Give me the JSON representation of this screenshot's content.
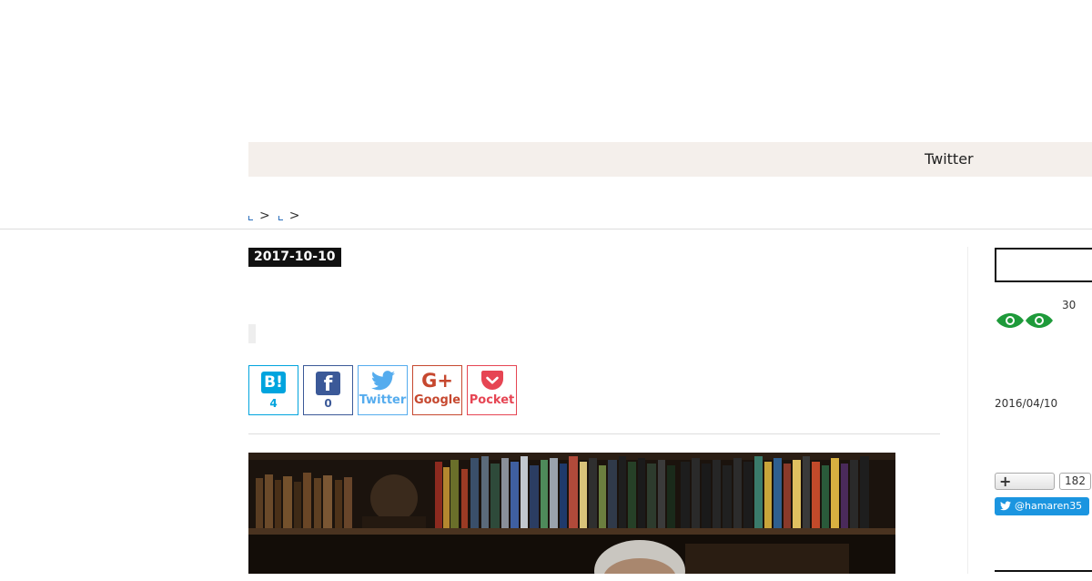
{
  "nav": {
    "twitter_label": "Twitter"
  },
  "breadcrumb": {
    "sep1": ">",
    "sep2": ">"
  },
  "article": {
    "date": "2017-10-10"
  },
  "share": {
    "hatena": {
      "logo": "B!",
      "count": "4"
    },
    "facebook": {
      "logo": "f",
      "count": "0"
    },
    "twitter": {
      "label": "Twitter"
    },
    "google": {
      "logo": "G+",
      "label": "Google"
    },
    "pocket": {
      "label": "Pocket"
    }
  },
  "sidebar": {
    "view_count": "30",
    "date": "2016/04/10",
    "follow_count": "182",
    "twitter_handle": "@hamaren35"
  },
  "colors": {
    "hatena": "#00a4de",
    "facebook": "#3b5998",
    "twitter": "#55acee",
    "google": "#c6482f",
    "pocket": "#e64553",
    "eye": "#1e9a3a",
    "nav_bg": "#f4efeb"
  },
  "icons": [
    "hatena-icon",
    "facebook-icon",
    "twitter-icon",
    "google-plus-icon",
    "pocket-icon",
    "eye-icon",
    "plus-icon",
    "twitter-bird-icon"
  ]
}
